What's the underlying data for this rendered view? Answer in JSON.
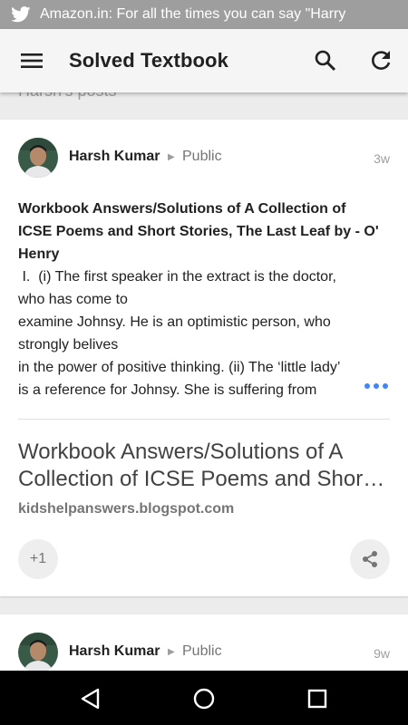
{
  "status_bar": {
    "notification_text": "Amazon.in: For all the times you can say \"Harry",
    "icon": "twitter-icon"
  },
  "app_bar": {
    "title": "Solved Textbook",
    "menu_icon": "menu-icon",
    "search_icon": "search-icon",
    "refresh_icon": "refresh-icon"
  },
  "feed": {
    "section_label": "Harsh's posts",
    "posts": [
      {
        "author": "Harsh Kumar",
        "visibility": "Public",
        "time": "3w",
        "heading_lines": [
          "Workbook Answers/Solutions of A Collection of",
          "ICSE Poems and Short Stories, The Last Leaf by - O'",
          "Henry"
        ],
        "body_lines": [
          " I.  (i) The first speaker in the extract is the doctor,",
          "who has come to",
          "examine Johnsy. He is an optimistic person, who",
          "strongly belives",
          "in the power of positive thinking.  (ii) The ‘little lady’",
          "is a reference for Johnsy. She is suffering from"
        ],
        "link_title_lines": [
          "Workbook Answers/Solutions of A",
          "Collection of ICSE Poems and Short Stories"
        ],
        "link_domain": "kidshelpanswers.blogspot.com",
        "plus_one_label": "+1",
        "share_icon": "share-icon"
      },
      {
        "author": "Harsh Kumar",
        "visibility": "Public",
        "time": "9w"
      }
    ]
  },
  "nav_bar": {
    "back_icon": "back-icon",
    "home_icon": "home-icon",
    "recents_icon": "recents-icon"
  },
  "colors": {
    "accent": "#4285f4",
    "status_bar": "#9e9e9e",
    "app_bar": "#f5f5f5"
  }
}
